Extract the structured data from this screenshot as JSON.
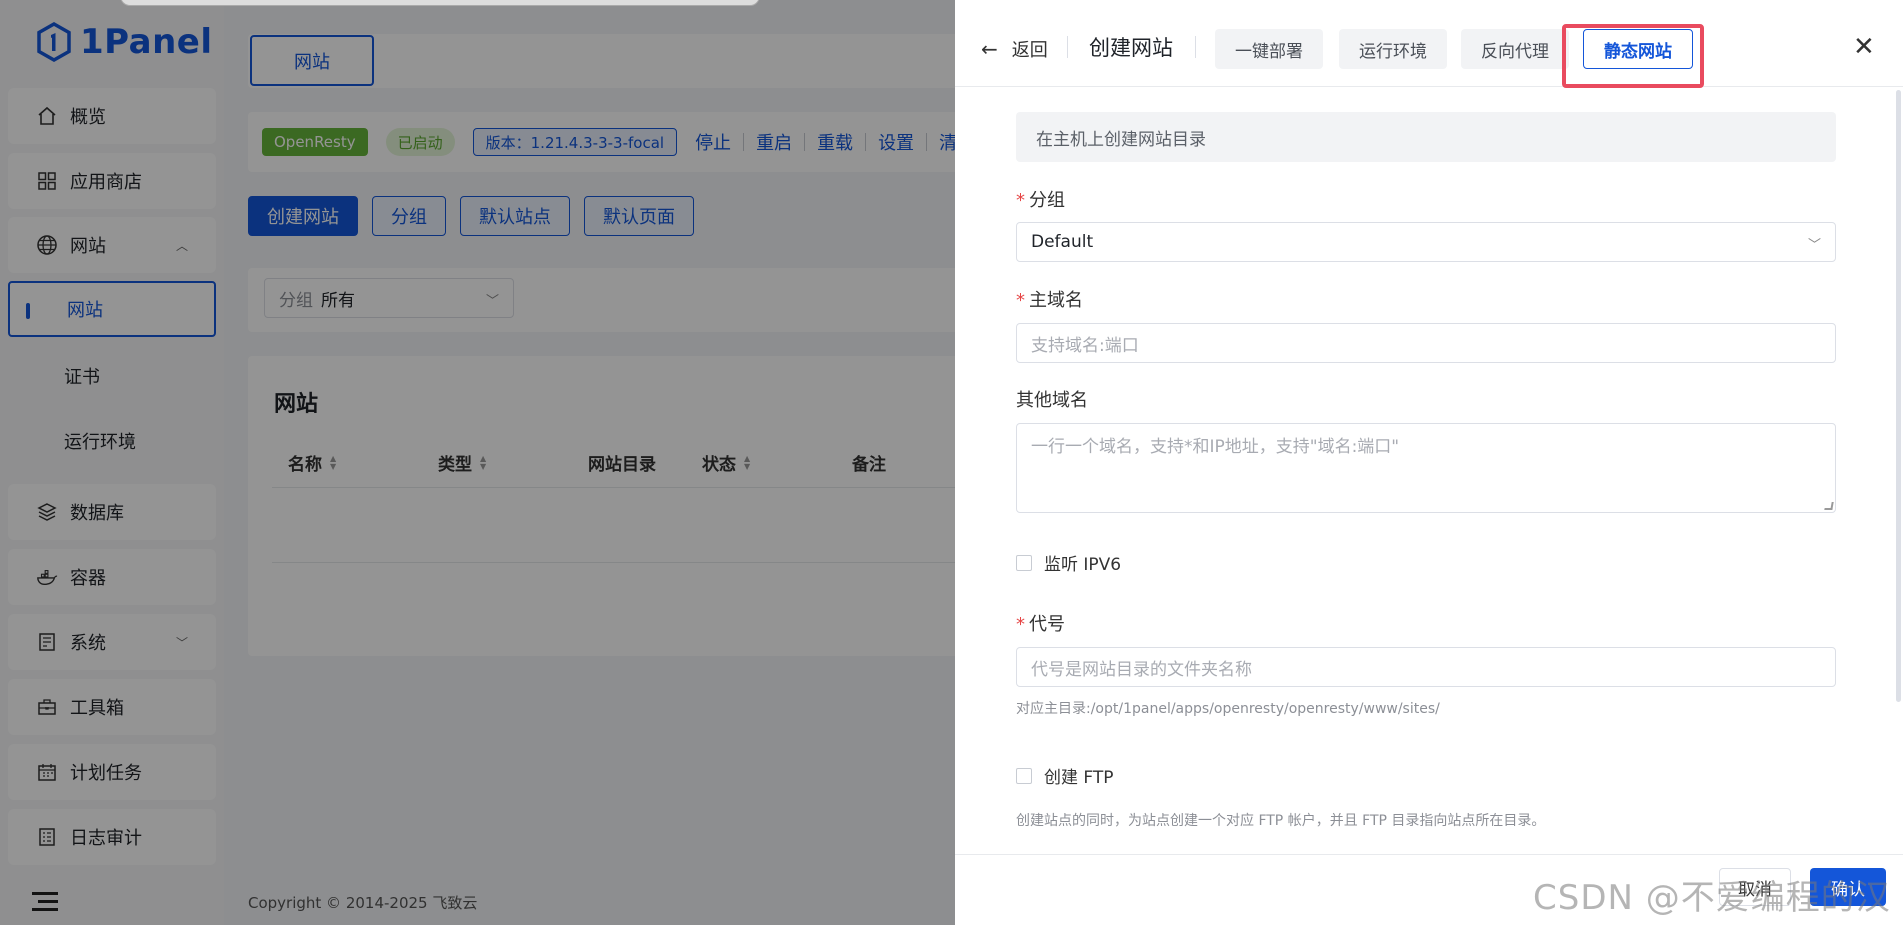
{
  "sidebar": {
    "logo_text": "1Panel",
    "items": [
      {
        "label": "概览"
      },
      {
        "label": "应用商店"
      },
      {
        "label": "网站"
      },
      {
        "label": "网站"
      },
      {
        "label": "证书"
      },
      {
        "label": "运行环境"
      },
      {
        "label": "数据库"
      },
      {
        "label": "容器"
      },
      {
        "label": "系统"
      },
      {
        "label": "工具箱"
      },
      {
        "label": "计划任务"
      },
      {
        "label": "日志审计"
      }
    ]
  },
  "main": {
    "tab_label": "网站",
    "status": {
      "app": "OpenResty",
      "state": "已启动",
      "version": "版本：1.21.4.3-3-3-focal",
      "actions": [
        "停止",
        "重启",
        "重载",
        "设置",
        "清"
      ]
    },
    "buttons": [
      "创建网站",
      "分组",
      "默认站点",
      "默认页面"
    ],
    "filter": {
      "label": "分组",
      "value": "所有"
    },
    "table": {
      "title": "网站",
      "columns": [
        "名称",
        "类型",
        "网站目录",
        "状态",
        "备注"
      ]
    },
    "footer": "Copyright © 2014-2025 飞致云"
  },
  "drawer": {
    "back": "返回",
    "title": "创建网站",
    "tabs": [
      "一键部署",
      "运行环境",
      "反向代理",
      "静态网站"
    ],
    "active_tab": "静态网站",
    "info": "在主机上创建网站目录",
    "group_label": "分组",
    "group_value": "Default",
    "domain_label": "主域名",
    "domain_placeholder": "支持域名:端口",
    "other_label": "其他域名",
    "other_placeholder": "一行一个域名，支持*和IP地址，支持\"域名:端口\"",
    "ipv6_label": "监听 IPV6",
    "alias_label": "代号",
    "alias_placeholder": "代号是网站目录的文件夹名称",
    "alias_hint": "对应主目录:/opt/1panel/apps/openresty/openresty/www/sites/",
    "ftp_label": "创建 FTP",
    "ftp_hint": "创建站点的同时，为站点创建一个对应 FTP 帐户，并且 FTP 目录指向站点所在目录。",
    "cancel": "取消",
    "confirm": "确认"
  },
  "watermark": "CSDN @不爱编程的汉",
  "colors": {
    "accent": "#1456d9",
    "highlight": "#e94b5f",
    "success": "#67b63b"
  }
}
